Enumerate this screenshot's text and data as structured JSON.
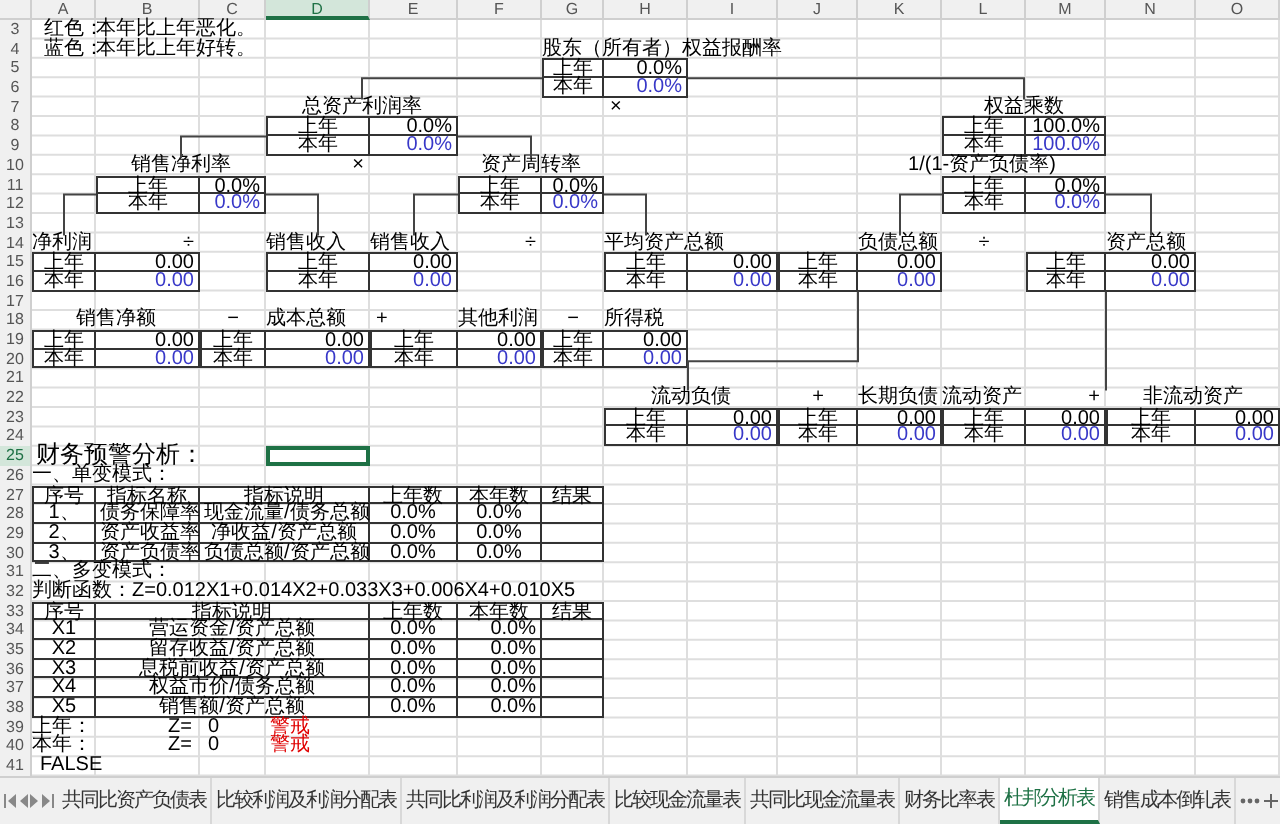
{
  "column_headers": [
    {
      "label": "A",
      "selected": false
    },
    {
      "label": "B",
      "selected": false
    },
    {
      "label": "C",
      "selected": false
    },
    {
      "label": "D",
      "selected": true
    },
    {
      "label": "E",
      "selected": false
    },
    {
      "label": "F",
      "selected": false
    },
    {
      "label": "G",
      "selected": false
    },
    {
      "label": "H",
      "selected": false
    },
    {
      "label": "I",
      "selected": false
    },
    {
      "label": "J",
      "selected": false
    },
    {
      "label": "K",
      "selected": false
    },
    {
      "label": "L",
      "selected": false
    },
    {
      "label": "M",
      "selected": false
    },
    {
      "label": "N",
      "selected": false
    },
    {
      "label": "O",
      "selected": false
    }
  ],
  "row_numbers": [
    {
      "label": "3",
      "selected": false
    },
    {
      "label": "4",
      "selected": false
    },
    {
      "label": "5",
      "selected": false
    },
    {
      "label": "6",
      "selected": false
    },
    {
      "label": "7",
      "selected": false
    },
    {
      "label": "8",
      "selected": false
    },
    {
      "label": "9",
      "selected": false
    },
    {
      "label": "10",
      "selected": false
    },
    {
      "label": "11",
      "selected": false
    },
    {
      "label": "12",
      "selected": false
    },
    {
      "label": "13",
      "selected": false
    },
    {
      "label": "14",
      "selected": false
    },
    {
      "label": "15",
      "selected": false
    },
    {
      "label": "16",
      "selected": false
    },
    {
      "label": "17",
      "selected": false
    },
    {
      "label": "18",
      "selected": false
    },
    {
      "label": "19",
      "selected": false
    },
    {
      "label": "20",
      "selected": false
    },
    {
      "label": "21",
      "selected": false
    },
    {
      "label": "22",
      "selected": false
    },
    {
      "label": "23",
      "selected": false
    },
    {
      "label": "24",
      "selected": false
    },
    {
      "label": "25",
      "selected": true
    },
    {
      "label": "26",
      "selected": false
    },
    {
      "label": "27",
      "selected": false
    },
    {
      "label": "28",
      "selected": false
    },
    {
      "label": "29",
      "selected": false
    },
    {
      "label": "30",
      "selected": false
    },
    {
      "label": "31",
      "selected": false
    },
    {
      "label": "32",
      "selected": false
    },
    {
      "label": "33",
      "selected": false
    },
    {
      "label": "34",
      "selected": false
    },
    {
      "label": "35",
      "selected": false
    },
    {
      "label": "36",
      "selected": false
    },
    {
      "label": "37",
      "selected": false
    },
    {
      "label": "38",
      "selected": false
    },
    {
      "label": "39",
      "selected": false
    },
    {
      "label": "40",
      "selected": false
    },
    {
      "label": "41",
      "selected": false
    }
  ],
  "legend": [
    {
      "label": "红色：",
      "text": "本年比上年恶化。"
    },
    {
      "label": "蓝色：",
      "text": "本年比上年好转。"
    }
  ],
  "dupont_tree": {
    "nodes": [
      {
        "title": "股东（所有者）权益报酬率",
        "rows": [
          {
            "label": "上年",
            "value": "0.0%",
            "kind": "prior"
          },
          {
            "label": "本年",
            "value": "0.0%",
            "kind": "current"
          }
        ]
      },
      {
        "title": "总资产利润率",
        "rows": [
          {
            "label": "上年",
            "value": "0.0%",
            "kind": "prior"
          },
          {
            "label": "本年",
            "value": "0.0%",
            "kind": "current"
          }
        ]
      },
      {
        "title": "权益乘数",
        "rows": [
          {
            "label": "上年",
            "value": "100.0%",
            "kind": "prior"
          },
          {
            "label": "本年",
            "value": "100.0%",
            "kind": "current"
          }
        ]
      },
      {
        "title": "销售净利率",
        "rows": [
          {
            "label": "上年",
            "value": "0.0%",
            "kind": "prior"
          },
          {
            "label": "本年",
            "value": "0.0%",
            "kind": "current"
          }
        ]
      },
      {
        "title": "资产周转率",
        "rows": [
          {
            "label": "上年",
            "value": "0.0%",
            "kind": "prior"
          },
          {
            "label": "本年",
            "value": "0.0%",
            "kind": "current"
          }
        ]
      },
      {
        "title": "1/(1-资产负债率)",
        "rows": [
          {
            "label": "上年",
            "value": "0.0%",
            "kind": "prior"
          },
          {
            "label": "本年",
            "value": "0.0%",
            "kind": "current"
          }
        ]
      },
      {
        "title": "净利润",
        "rows": [
          {
            "label": "上年",
            "value": "0.00",
            "kind": "prior"
          },
          {
            "label": "本年",
            "value": "0.00",
            "kind": "current"
          }
        ]
      },
      {
        "title": "销售收入",
        "rows": [
          {
            "label": "上年",
            "value": "0.00",
            "kind": "prior"
          },
          {
            "label": "本年",
            "value": "0.00",
            "kind": "current"
          }
        ]
      },
      {
        "title": "平均资产总额",
        "rows": [
          {
            "label": "上年",
            "value": "0.00",
            "kind": "prior"
          },
          {
            "label": "本年",
            "value": "0.00",
            "kind": "current"
          }
        ]
      },
      {
        "title": "负债总额",
        "rows": [
          {
            "label": "上年",
            "value": "0.00",
            "kind": "prior"
          },
          {
            "label": "本年",
            "value": "0.00",
            "kind": "current"
          }
        ]
      },
      {
        "title": "资产总额",
        "rows": [
          {
            "label": "上年",
            "value": "0.00",
            "kind": "prior"
          },
          {
            "label": "本年",
            "value": "0.00",
            "kind": "current"
          }
        ]
      },
      {
        "title": "销售净额",
        "rows": [
          {
            "label": "上年",
            "value": "0.00",
            "kind": "prior"
          },
          {
            "label": "本年",
            "value": "0.00",
            "kind": "current"
          }
        ]
      },
      {
        "title": "成本总额",
        "rows": [
          {
            "label": "上年",
            "value": "0.00",
            "kind": "prior"
          },
          {
            "label": "本年",
            "value": "0.00",
            "kind": "current"
          }
        ]
      },
      {
        "title": "其他利润",
        "rows": [
          {
            "label": "上年",
            "value": "0.00",
            "kind": "prior"
          },
          {
            "label": "本年",
            "value": "0.00",
            "kind": "current"
          }
        ]
      },
      {
        "title": "所得税",
        "rows": [
          {
            "label": "上年",
            "value": "0.00",
            "kind": "prior"
          },
          {
            "label": "本年",
            "value": "0.00",
            "kind": "current"
          }
        ]
      },
      {
        "title": "流动负债",
        "rows": [
          {
            "label": "上年",
            "value": "0.00",
            "kind": "prior"
          },
          {
            "label": "本年",
            "value": "0.00",
            "kind": "current"
          }
        ]
      },
      {
        "title": "长期负债",
        "rows": [
          {
            "label": "上年",
            "value": "0.00",
            "kind": "prior"
          },
          {
            "label": "本年",
            "value": "0.00",
            "kind": "current"
          }
        ]
      },
      {
        "title": "流动资产",
        "rows": [
          {
            "label": "上年",
            "value": "0.00",
            "kind": "prior"
          },
          {
            "label": "本年",
            "value": "0.00",
            "kind": "current"
          }
        ]
      },
      {
        "title": "非流动资产",
        "rows": [
          {
            "label": "上年",
            "value": "0.00",
            "kind": "prior"
          },
          {
            "label": "本年",
            "value": "0.00",
            "kind": "current"
          }
        ]
      }
    ],
    "operators": [
      "×",
      "×",
      "÷",
      "÷",
      "÷",
      "−",
      "+",
      "−",
      "+",
      "+"
    ],
    "extra_titles": [
      "销售收入"
    ]
  },
  "warning_analysis": {
    "title": "财务预警分析：",
    "single": {
      "heading": "一、单变模式：",
      "columns": [
        "序号",
        "指标名称",
        "指标说明",
        "上年数",
        "本年数",
        "结果"
      ],
      "rows": [
        [
          "1、",
          "债务保障率",
          "现金流量/债务总额",
          "0.0%",
          "0.0%"
        ],
        [
          "2、",
          "资产收益率",
          "净收益/资产总额",
          "0.0%",
          "0.0%"
        ],
        [
          "3、",
          "资产负债率",
          "负债总额/资产总额",
          "0.0%",
          "0.0%"
        ]
      ]
    },
    "multi": {
      "heading": "二、多变模式：",
      "formula": "判断函数：Z=0.012X1+0.014X2+0.033X3+0.006X4+0.010X5",
      "columns": [
        "序号",
        "指标说明",
        "上年数",
        "本年数",
        "结果"
      ],
      "rows": [
        [
          "X1",
          "营运资金/资产总额",
          "0.0%",
          "0.0%"
        ],
        [
          "X2",
          "留存收益/资产总额",
          "0.0%",
          "0.0%"
        ],
        [
          "X3",
          "息税前收益/资产总额",
          "0.0%",
          "0.0%"
        ],
        [
          "X4",
          "权益市价/债务总额",
          "0.0%",
          "0.0%"
        ],
        [
          "X5",
          "销售额/资产总额",
          "0.0%",
          "0.0%"
        ]
      ]
    },
    "results": [
      {
        "label": "上年：",
        "z_label": "Z=",
        "z_value": "0",
        "status": "警戒"
      },
      {
        "label": "本年：",
        "z_label": "Z=",
        "z_value": "0",
        "status": "警戒"
      }
    ],
    "flag": "FALSE"
  },
  "tabs": [
    {
      "label": "共同比资产负债表",
      "selected": false
    },
    {
      "label": "比较利润及利润分配表",
      "selected": false
    },
    {
      "label": "共同比利润及利润分配表",
      "selected": false
    },
    {
      "label": "比较现金流量表",
      "selected": false
    },
    {
      "label": "共同比现金流量表",
      "selected": false
    },
    {
      "label": "财务比率表",
      "selected": false
    },
    {
      "label": "杜邦分析表",
      "selected": true
    },
    {
      "label": "销售成本倒轧表",
      "selected": false
    }
  ]
}
